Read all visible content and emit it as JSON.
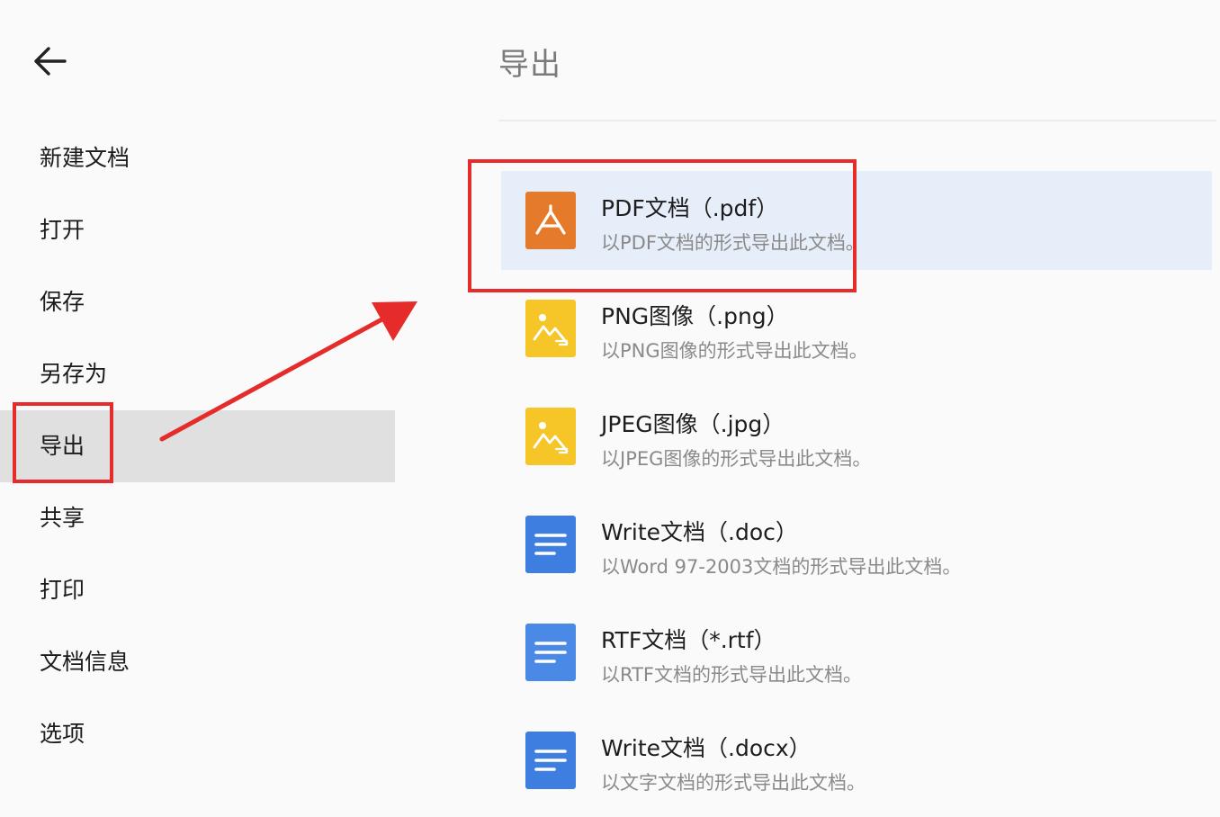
{
  "colors": {
    "accent_red": "#e62b2b",
    "pdf_orange": "#e57a2a",
    "image_yellow": "#f6c628",
    "doc_blue": "#3d7ee0",
    "selected_bg": "#e6eefa",
    "active_sidebar_bg": "#e0e0e1"
  },
  "header": {
    "back_icon": "arrow-left-icon"
  },
  "sidebar": {
    "items": [
      {
        "label": "新建文档"
      },
      {
        "label": "打开"
      },
      {
        "label": "保存"
      },
      {
        "label": "另存为"
      },
      {
        "label": "导出",
        "active": true
      },
      {
        "label": "共享"
      },
      {
        "label": "打印"
      },
      {
        "label": "文档信息"
      },
      {
        "label": "选项"
      }
    ]
  },
  "panel": {
    "title": "导出",
    "items": [
      {
        "icon": "pdf-icon",
        "title": "PDF文档（.pdf）",
        "desc": "以PDF文档的形式导出此文档。",
        "selected": true
      },
      {
        "icon": "image-icon",
        "title": "PNG图像（.png）",
        "desc": "以PNG图像的形式导出此文档。"
      },
      {
        "icon": "image-icon",
        "title": "JPEG图像（.jpg）",
        "desc": "以JPEG图像的形式导出此文档。"
      },
      {
        "icon": "document-icon",
        "title": "Write文档（.doc）",
        "desc": "以Word 97-2003文档的形式导出此文档。"
      },
      {
        "icon": "document-icon",
        "title": "RTF文档（*.rtf）",
        "desc": "以RTF文档的形式导出此文档。"
      },
      {
        "icon": "document-icon",
        "title": "Write文档（.docx）",
        "desc": "以文字文档的形式导出此文档。"
      }
    ]
  }
}
